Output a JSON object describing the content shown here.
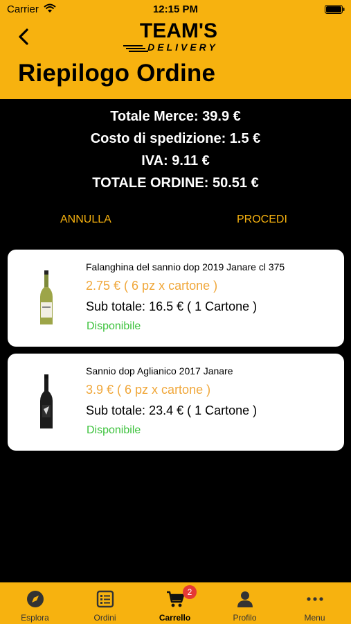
{
  "status_bar": {
    "carrier": "Carrier",
    "time": "12:15 PM"
  },
  "header": {
    "logo_line1": "TEAM'S",
    "logo_line2": "DELIVERY",
    "title": "Riepilogo Ordine"
  },
  "summary": {
    "merce": "Totale Merce: 39.9 €",
    "spedizione": "Costo di spedizione: 1.5 €",
    "iva": "IVA: 9.11 €",
    "totale": "TOTALE ORDINE: 50.51 €"
  },
  "actions": {
    "cancel": "ANNULLA",
    "proceed": "PROCEDI"
  },
  "items": [
    {
      "name": "Falanghina del sannio dop 2019 Janare cl 375",
      "price": "2.75 € ( 6 pz x cartone )",
      "subtotal": "Sub totale: 16.5 € ( 1  Cartone )",
      "status": "Disponibile"
    },
    {
      "name": "Sannio dop Aglianico 2017 Janare",
      "price": "3.9 € ( 6 pz x cartone )",
      "subtotal": "Sub totale: 23.4 € ( 1  Cartone )",
      "status": "Disponibile"
    }
  ],
  "tabbar": {
    "tabs": [
      {
        "label": "Esplora",
        "icon": "compass-icon"
      },
      {
        "label": "Ordini",
        "icon": "list-icon"
      },
      {
        "label": "Carrello",
        "icon": "cart-icon"
      },
      {
        "label": "Profilo",
        "icon": "person-icon"
      },
      {
        "label": "Menu",
        "icon": "more-icon"
      }
    ],
    "cart_badge": "2"
  },
  "colors": {
    "accent": "#F7B20F",
    "price": "#F0A73A",
    "available": "#3CC23C",
    "badge": "#E53935"
  }
}
